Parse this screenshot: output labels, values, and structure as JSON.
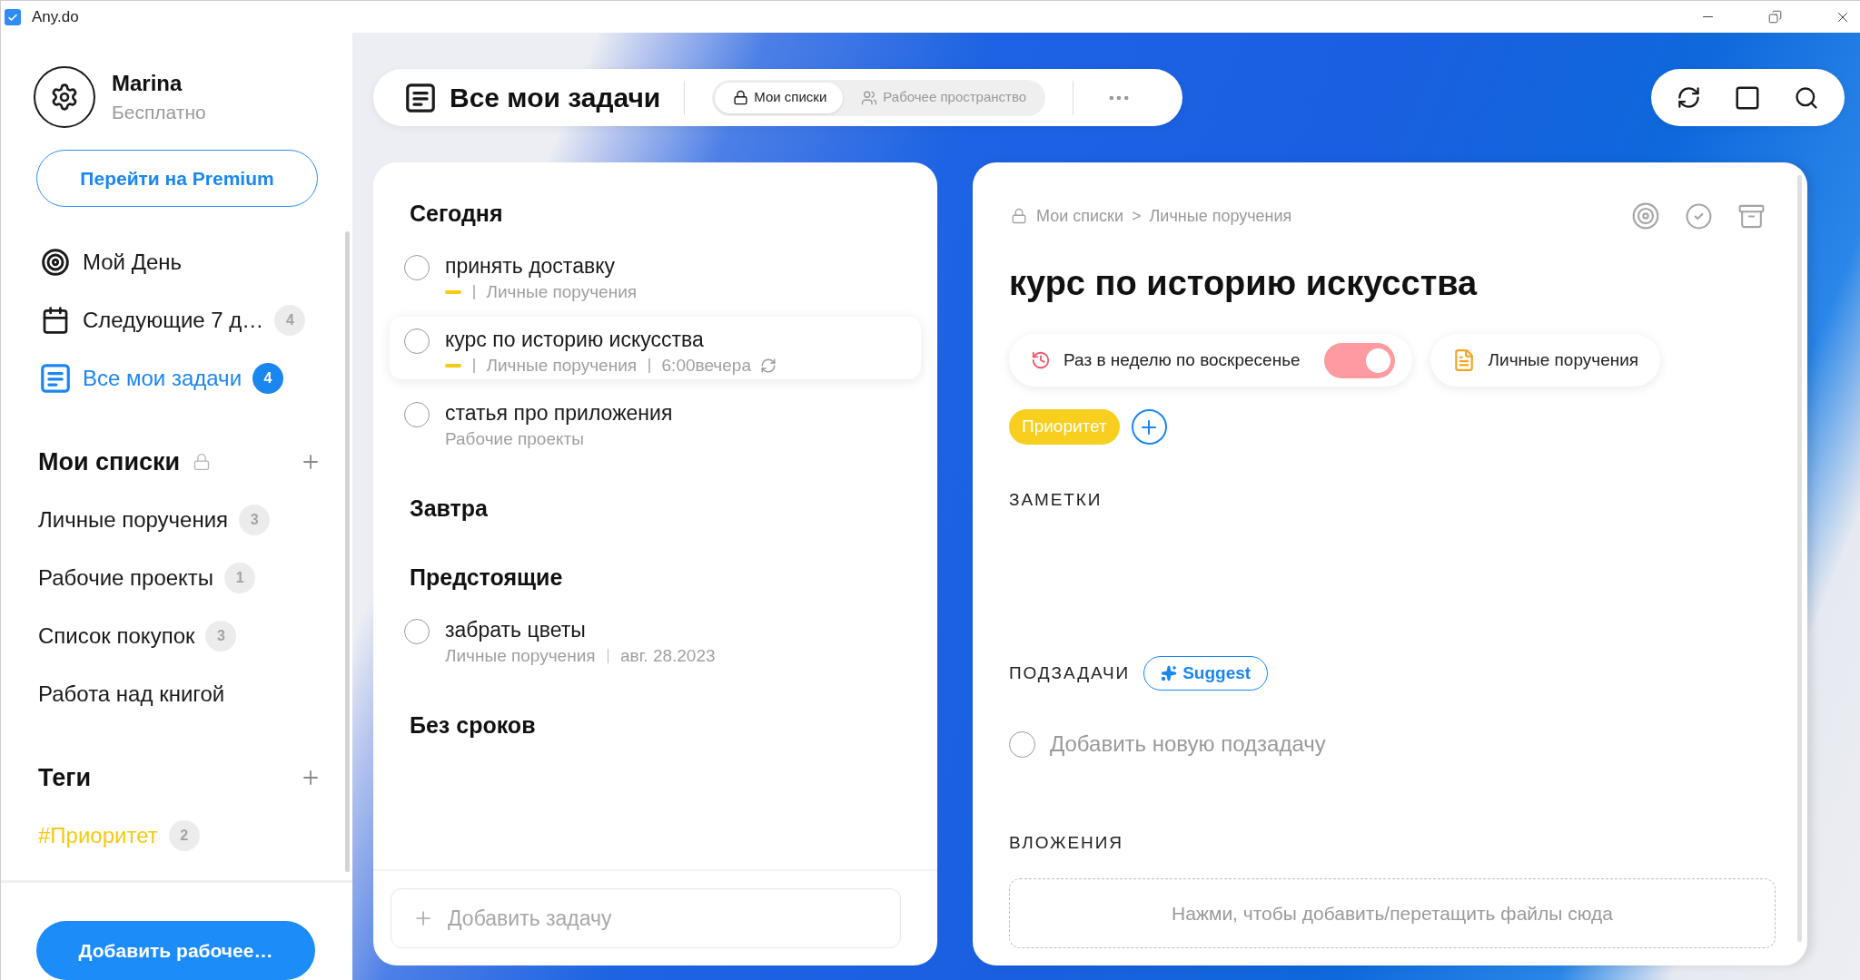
{
  "window": {
    "title": "Any.do"
  },
  "sidebar": {
    "profile": {
      "name": "Marina",
      "plan": "Бесплатно"
    },
    "premium_button": "Перейти на Premium",
    "nav": [
      {
        "kind": "my_day",
        "label": "Мой День",
        "selected": false
      },
      {
        "kind": "next_7_days",
        "label": "Следующие 7 д…",
        "count": "4",
        "selected": false
      },
      {
        "kind": "all_tasks",
        "label": "Все мои задачи",
        "count": "4",
        "selected": true
      }
    ],
    "lists": {
      "title": "Мои списки",
      "items": [
        {
          "label": "Личные поручения",
          "count": "3"
        },
        {
          "label": "Рабочие проекты",
          "count": "1"
        },
        {
          "label": "Список покупок",
          "count": "3"
        },
        {
          "label": "Работа над книгой"
        }
      ]
    },
    "tags": {
      "title": "Теги",
      "items": [
        {
          "label": "#Приоритет",
          "count": "2"
        }
      ]
    },
    "add_workspace_button": "Добавить рабочее…"
  },
  "header": {
    "title": "Все мои задачи",
    "scope_tabs": [
      {
        "kind": "private",
        "label": "Мои списки",
        "selected": true
      },
      {
        "kind": "team",
        "label": "Рабочее пространство",
        "selected": false
      }
    ]
  },
  "task_list": {
    "groups": [
      {
        "title": "Сегодня",
        "tasks": [
          {
            "title": "принять доставку",
            "checked": false,
            "priority": true,
            "list": "Личные поручения",
            "repeat": false,
            "selected": false
          },
          {
            "title": "курс по историю искусства",
            "checked": false,
            "priority": true,
            "list": "Личные поручения",
            "due": "6:00вечера",
            "repeat": true,
            "selected": true
          },
          {
            "title": "статья про приложения",
            "checked": false,
            "priority": false,
            "list": "Рабочие проекты",
            "repeat": false,
            "selected": false
          }
        ]
      },
      {
        "title": "Завтра"
      },
      {
        "title": "Предстоящие",
        "tasks": [
          {
            "title": "забрать цветы",
            "checked": false,
            "priority": false,
            "list": "Личные поручения",
            "due": "авг. 28.2023",
            "repeat": false,
            "selected": false
          }
        ]
      },
      {
        "title": "Без сроков"
      }
    ],
    "add_task": {
      "placeholder": "Добавить задачу"
    }
  },
  "detail": {
    "breadcrumb": {
      "scope": "Мои списки",
      "separator": ">",
      "list": "Личные поручения"
    },
    "title": "курс по историю искусства",
    "recurrence": {
      "label": "Раз в неделю по воскресенье",
      "on": true
    },
    "list_chip": "Личные поручения",
    "tags": [
      {
        "label": "Приоритет"
      }
    ],
    "notes_heading": "ЗАМЕТКИ",
    "subtasks": {
      "heading": "ПОДЗАДАЧИ",
      "suggest_button": "Suggest",
      "add_placeholder": "Добавить новую подзадачу"
    },
    "attachments": {
      "heading": "ВЛОЖЕНИЯ",
      "dropzone": "Нажми, чтобы добавить/перетащить файлы сюда"
    }
  }
}
